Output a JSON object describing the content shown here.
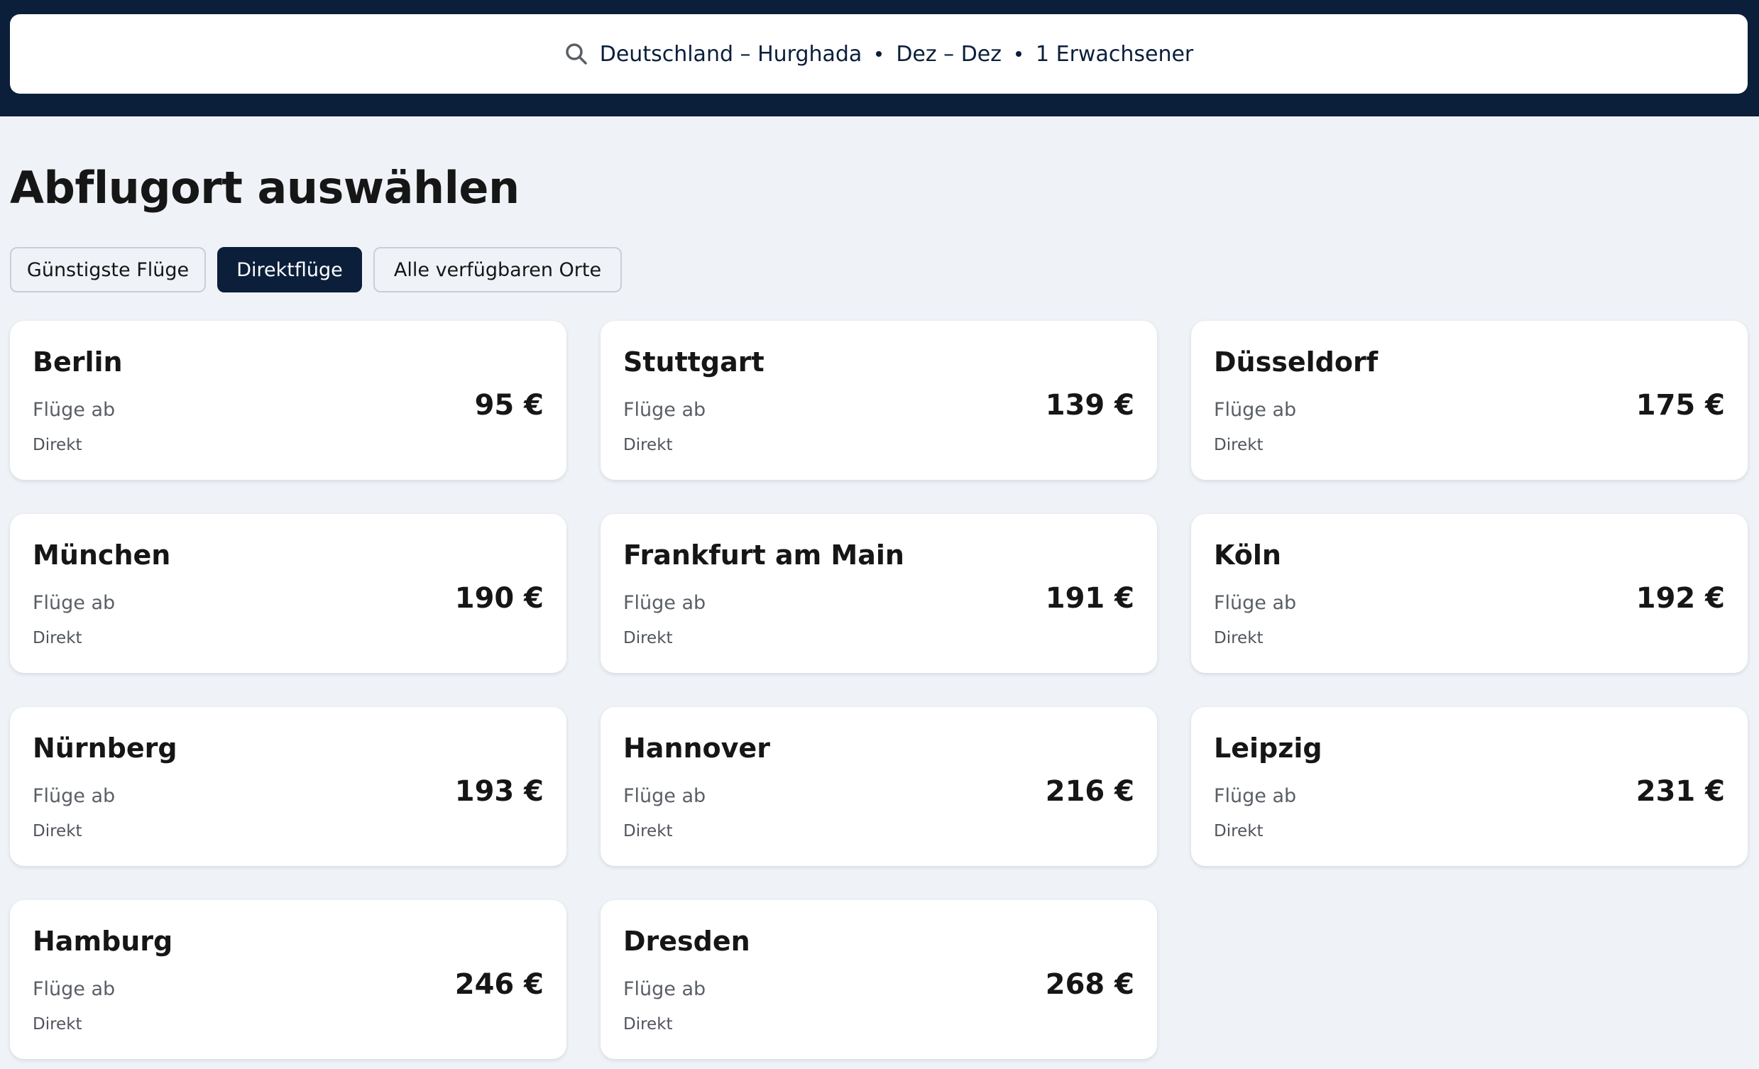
{
  "search": {
    "route": "Deutschland – Hurghada",
    "dates": "Dez – Dez",
    "travellers": "1 Erwachsener"
  },
  "page_title": "Abflugort auswählen",
  "filters": [
    {
      "label": "Günstigste Flüge",
      "active": false
    },
    {
      "label": "Direktflüge",
      "active": true
    },
    {
      "label": "Alle verfügbaren Orte",
      "active": false
    }
  ],
  "cards": [
    {
      "city": "Berlin",
      "from_label": "Flüge ab",
      "price": "95 €",
      "type": "Direkt"
    },
    {
      "city": "Stuttgart",
      "from_label": "Flüge ab",
      "price": "139 €",
      "type": "Direkt"
    },
    {
      "city": "Düsseldorf",
      "from_label": "Flüge ab",
      "price": "175 €",
      "type": "Direkt"
    },
    {
      "city": "München",
      "from_label": "Flüge ab",
      "price": "190 €",
      "type": "Direkt"
    },
    {
      "city": "Frankfurt am Main",
      "from_label": "Flüge ab",
      "price": "191 €",
      "type": "Direkt"
    },
    {
      "city": "Köln",
      "from_label": "Flüge ab",
      "price": "192 €",
      "type": "Direkt"
    },
    {
      "city": "Nürnberg",
      "from_label": "Flüge ab",
      "price": "193 €",
      "type": "Direkt"
    },
    {
      "city": "Hannover",
      "from_label": "Flüge ab",
      "price": "216 €",
      "type": "Direkt"
    },
    {
      "city": "Leipzig",
      "from_label": "Flüge ab",
      "price": "231 €",
      "type": "Direkt"
    },
    {
      "city": "Hamburg",
      "from_label": "Flüge ab",
      "price": "246 €",
      "type": "Direkt"
    },
    {
      "city": "Dresden",
      "from_label": "Flüge ab",
      "price": "268 €",
      "type": "Direkt"
    }
  ],
  "colors": {
    "header_bg": "#0b1f3b",
    "page_bg": "#eff3f8",
    "active_filter_bg": "#0b1f3b"
  },
  "icons": {
    "search": "search-icon"
  }
}
